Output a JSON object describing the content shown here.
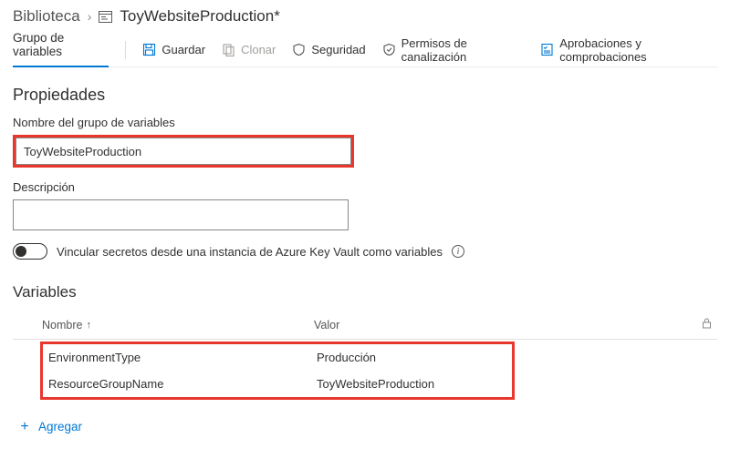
{
  "breadcrumb": {
    "root": "Biblioteca",
    "current": "ToyWebsiteProduction*"
  },
  "toolbar": {
    "pivot": "Grupo de variables",
    "save": "Guardar",
    "clone": "Clonar",
    "security": "Seguridad",
    "pipeline_permissions": "Permisos de canalización",
    "approvals": "Aprobaciones y comprobaciones"
  },
  "properties": {
    "heading": "Propiedades",
    "name_label": "Nombre del grupo de variables",
    "name_value": "ToyWebsiteProduction",
    "description_label": "Descripción",
    "description_value": "",
    "keyvault_toggle_label": "Vincular secretos desde una instancia de Azure Key Vault como variables"
  },
  "variables": {
    "heading": "Variables",
    "col_name": "Nombre",
    "col_value": "Valor",
    "rows": [
      {
        "name": "EnvironmentType",
        "value": "Producción"
      },
      {
        "name": "ResourceGroupName",
        "value": "ToyWebsiteProduction"
      }
    ],
    "add_label": "Agregar"
  }
}
